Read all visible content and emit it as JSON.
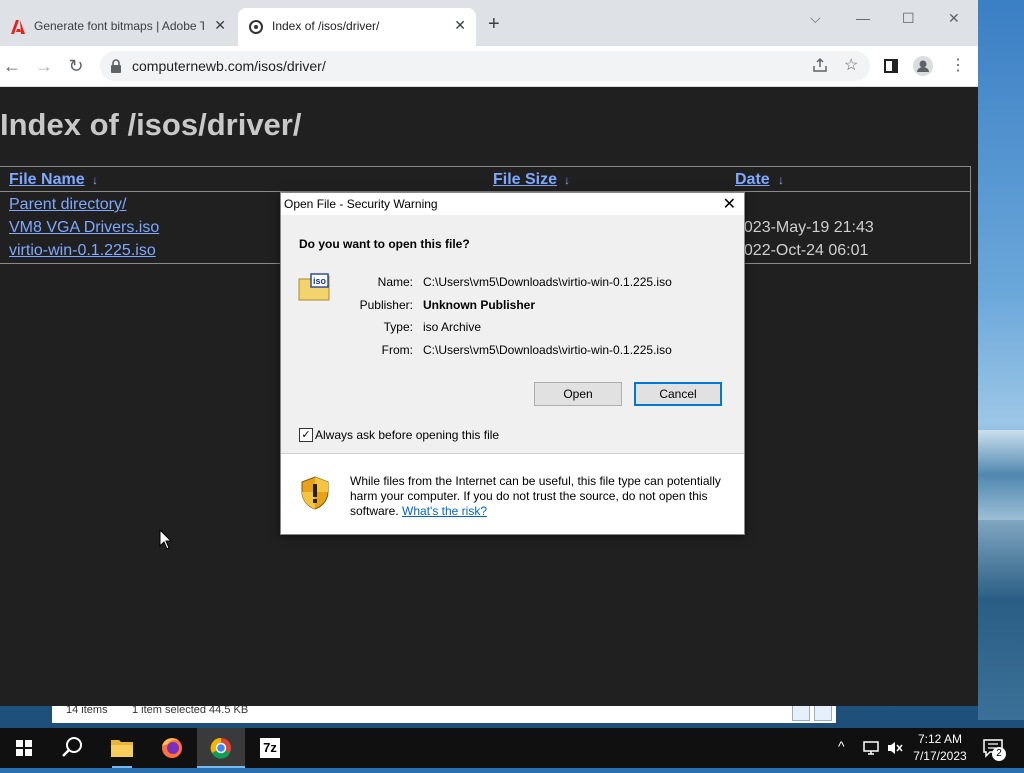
{
  "browser": {
    "tabs": [
      {
        "title": "Generate font bitmaps | Adobe T",
        "active": false
      },
      {
        "title": "Index of /isos/driver/",
        "active": true
      }
    ],
    "url": "computernewb.com/isos/driver/"
  },
  "page": {
    "heading": "Index of /isos/driver/",
    "columns": {
      "name": "File Name",
      "size": "File Size",
      "date": "Date",
      "sort_glyph": "↓"
    },
    "rows": [
      {
        "name": "Parent directory/",
        "date": ""
      },
      {
        "name": "VM8 VGA Drivers.iso",
        "date": "2023-May-19 21:43"
      },
      {
        "name": "virtio-win-0.1.225.iso",
        "date": "2022-Oct-24 06:01"
      }
    ]
  },
  "explorer_status": {
    "items": "14 items",
    "selected": "1 item selected  44.5 KB"
  },
  "dialog": {
    "title": "Open File - Security Warning",
    "question": "Do you want to open this file?",
    "file_icon_text": "iso",
    "fields": {
      "name_label": "Name:",
      "name_value": "C:\\Users\\vm5\\Downloads\\virtio-win-0.1.225.iso",
      "publisher_label": "Publisher:",
      "publisher_value": "Unknown Publisher",
      "type_label": "Type:",
      "type_value": "iso Archive",
      "from_label": "From:",
      "from_value": "C:\\Users\\vm5\\Downloads\\virtio-win-0.1.225.iso"
    },
    "open_label": "Open",
    "cancel_label": "Cancel",
    "checkbox_label": "Always ask before opening this file",
    "checkbox_checked": true,
    "warning_text": "While files from the Internet can be useful, this file type can potentially harm your computer. If you do not trust the source, do not open this software.",
    "risk_link": "What's the risk?"
  },
  "taskbar": {
    "time": "7:12 AM",
    "date": "7/17/2023",
    "notification_count": "2",
    "seven_zip_label": "7z"
  },
  "colors": {
    "link": "#7fa8ff",
    "accent": "#0078d7"
  }
}
